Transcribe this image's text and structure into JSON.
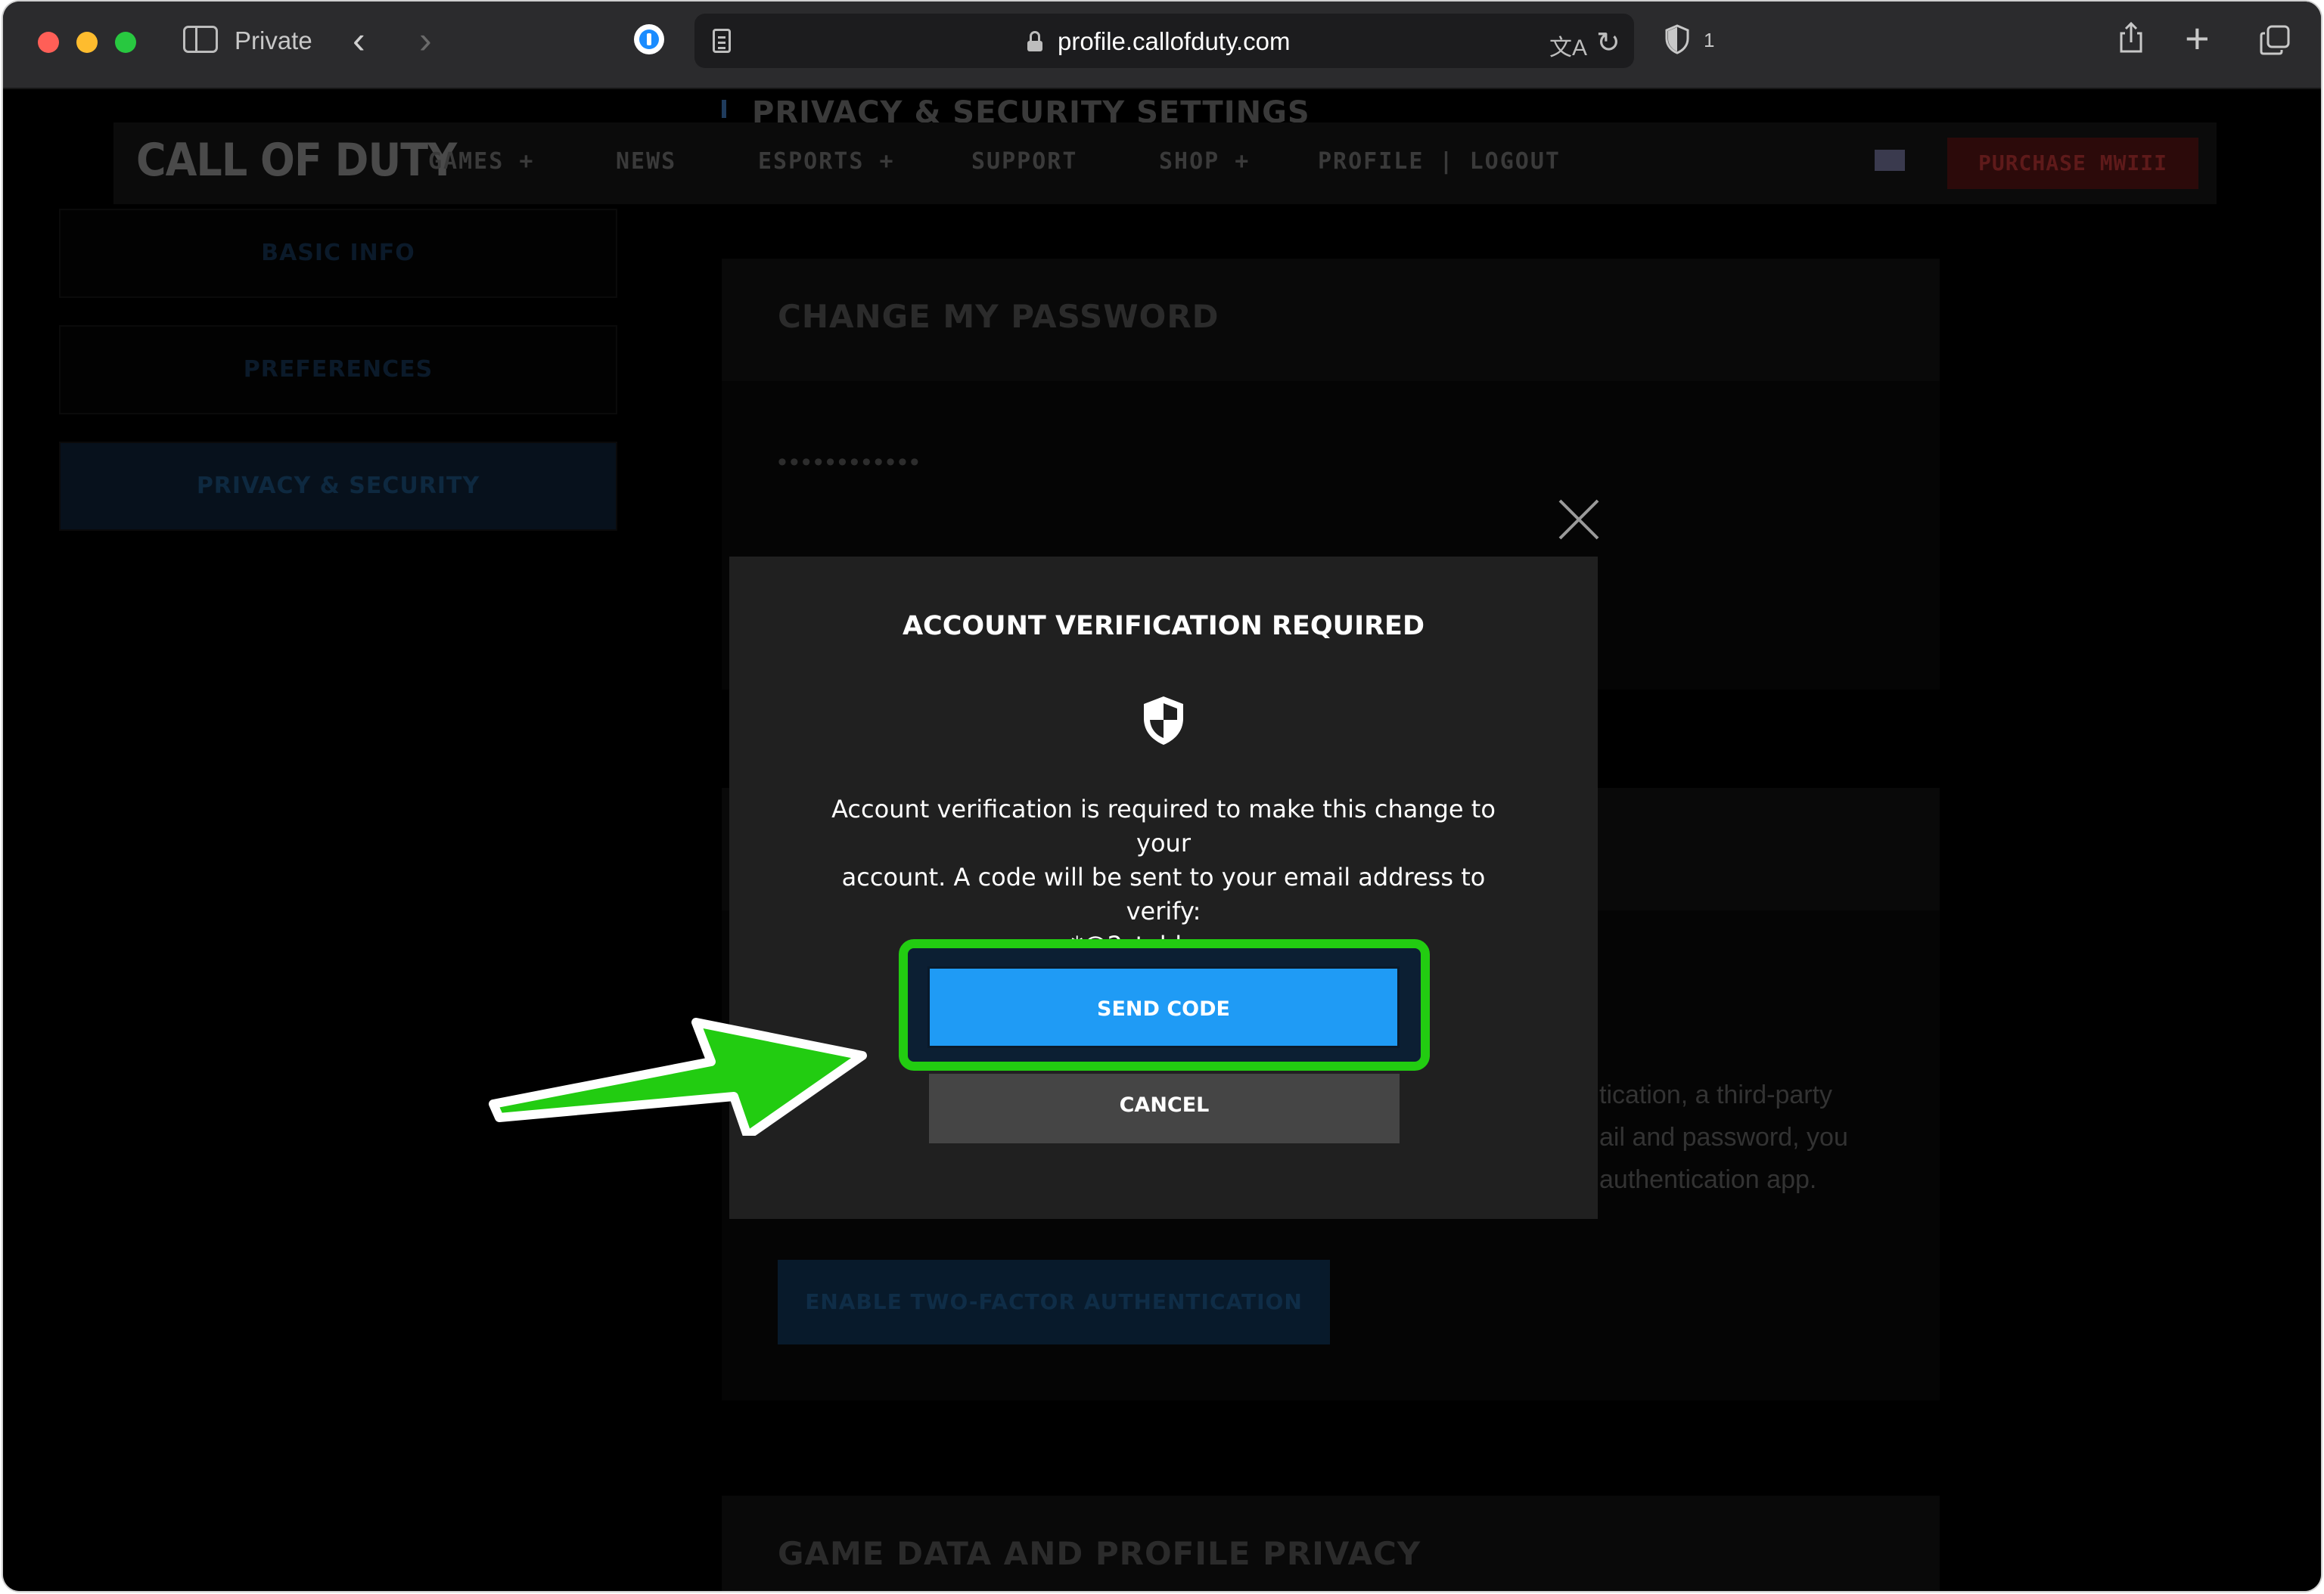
{
  "browser": {
    "private_label": "Private",
    "url": "profile.callofduty.com",
    "shield_count": "1"
  },
  "page": {
    "title": "PRIVACY & SECURITY SETTINGS",
    "logo": "CALL OF DUTY",
    "nav": [
      "GAMES  +",
      "NEWS",
      "ESPORTS  +",
      "SUPPORT",
      "SHOP  +",
      "PROFILE  |  LOGOUT"
    ],
    "purchase_label": "PURCHASE MWIII",
    "sidebar": [
      "BASIC INFO",
      "PREFERENCES",
      "PRIVACY & SECURITY"
    ],
    "change_password": {
      "title": "CHANGE MY PASSWORD",
      "masked_password": "••••••••••••"
    },
    "twofa_text": [
      "tication, a third-party",
      "ail and password, you",
      "authentication app."
    ],
    "twofa_button": "ENABLE TWO-FACTOR AUTHENTICATION",
    "game_data_title": "GAME DATA AND PROFILE PRIVACY"
  },
  "modal": {
    "title": "ACCOUNT VERIFICATION REQUIRED",
    "body_line1": "Account verification is required to make this change to your",
    "body_line2": "account. A code will be sent to your email address to verify:",
    "body_line3": "*@2stable.com",
    "send_label": "SEND CODE",
    "cancel_label": "CANCEL"
  },
  "annotation": {
    "highlight_color": "#22cc11",
    "arrow_color": "#22cc11"
  },
  "icons": [
    "sidebar-icon",
    "back-icon",
    "forward-icon",
    "password-manager-icon",
    "reader-icon",
    "lock-icon",
    "translate-icon",
    "reload-icon",
    "privacy-shield-icon",
    "share-icon",
    "new-tab-icon",
    "tab-overview-icon",
    "close-icon",
    "shield-icon"
  ]
}
